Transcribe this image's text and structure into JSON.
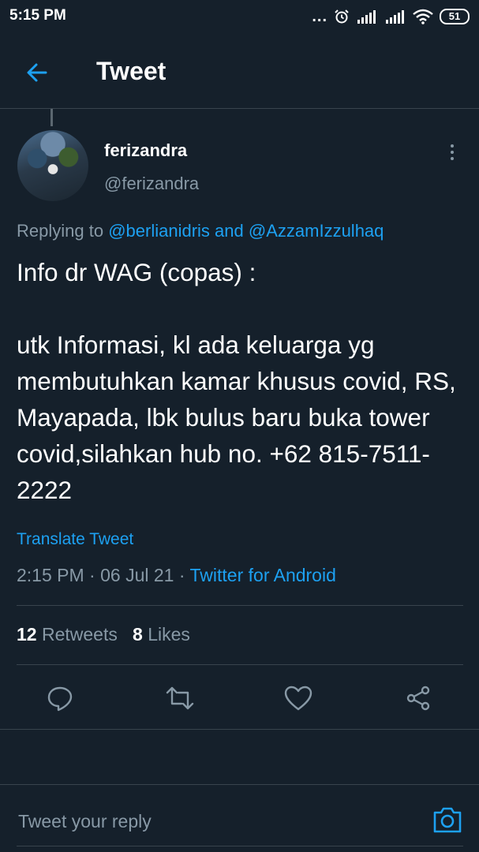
{
  "status_bar": {
    "time": "5:15 PM",
    "dots": "...",
    "battery": "51"
  },
  "header": {
    "title": "Tweet"
  },
  "tweet": {
    "display_name": "ferizandra",
    "handle": "@ferizandra",
    "replying_to_prefix": "Replying to",
    "replying_to_user1": "@berlianidris",
    "replying_to_and": "and",
    "replying_to_user2": "@AzzamIzzulhaq",
    "text": "Info dr WAG (copas) :\n\nutk Informasi, kl ada keluarga yg membutuhkan kamar khusus covid,  RS, Mayapada, lbk bulus baru buka tower covid,silahkan hub no. +62 815-7511-2222",
    "translate_label": "Translate Tweet",
    "time": "2:15 PM",
    "date": "06 Jul 21",
    "separator": "·",
    "source": "Twitter for Android",
    "retweets_count": "12",
    "retweets_label": "Retweets",
    "likes_count": "8",
    "likes_label": "Likes"
  },
  "icons": {
    "back": "arrow-left-icon",
    "more": "more-vertical-icon",
    "reply": "reply-icon",
    "retweet": "retweet-icon",
    "like": "heart-icon",
    "share": "share-icon",
    "camera": "camera-icon"
  },
  "reply_box": {
    "placeholder": "Tweet your reply"
  },
  "colors": {
    "background": "#15202b",
    "accent": "#1da1f2",
    "secondary_text": "#8899a6",
    "divider": "#38444d"
  }
}
